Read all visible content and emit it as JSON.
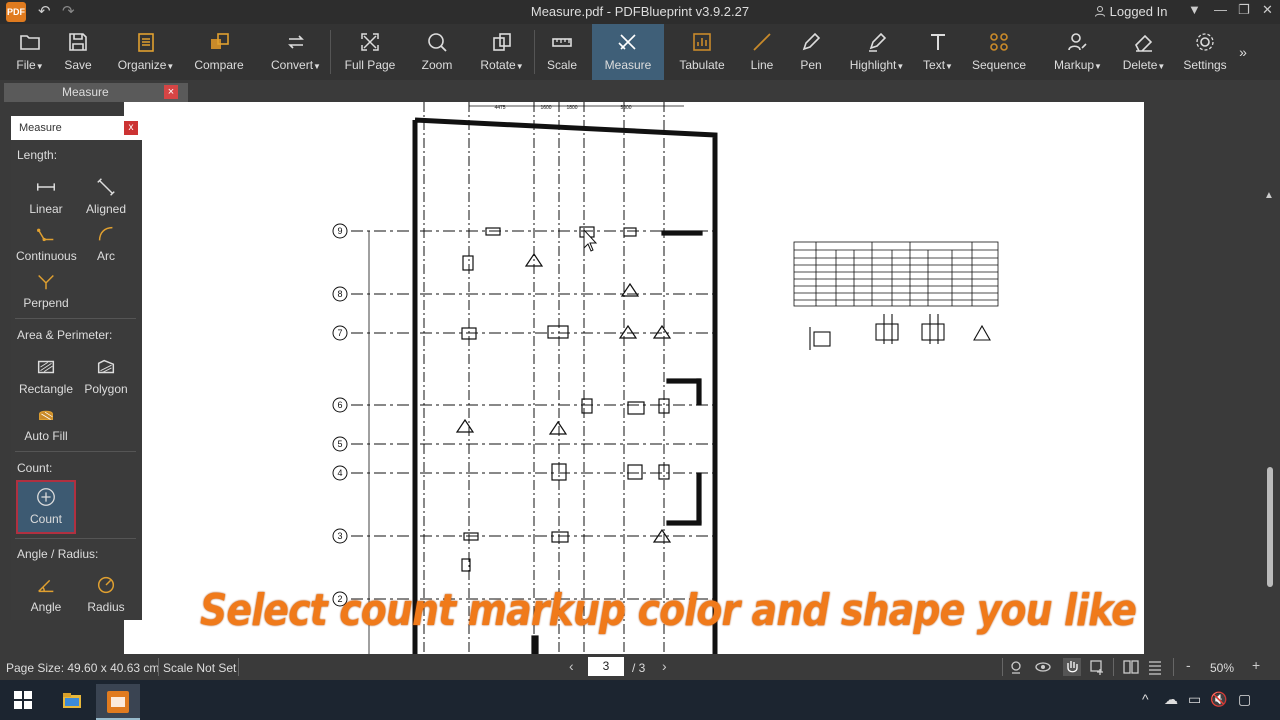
{
  "titlebar": {
    "app_icon_label": "PDF",
    "title": "Measure.pdf - PDFBlueprint v3.9.2.27",
    "login": "Logged In"
  },
  "ribbon": {
    "tools": [
      {
        "label": "File",
        "icon": "folder-icon",
        "dropdown": true
      },
      {
        "label": "Save",
        "icon": "save-icon"
      },
      {
        "label": "Organize",
        "icon": "organize-icon",
        "dropdown": true
      },
      {
        "label": "Compare",
        "icon": "compare-icon"
      },
      {
        "label": "Convert",
        "icon": "convert-icon",
        "dropdown": true
      },
      {
        "label": "Full Page",
        "icon": "full-page-icon"
      },
      {
        "label": "Zoom",
        "icon": "zoom-icon"
      },
      {
        "label": "Rotate",
        "icon": "rotate-icon",
        "dropdown": true
      },
      {
        "label": "Scale",
        "icon": "scale-icon"
      },
      {
        "label": "Measure",
        "icon": "measure-icon",
        "active": true
      },
      {
        "label": "Tabulate",
        "icon": "tabulate-icon"
      },
      {
        "label": "Line",
        "icon": "line-icon"
      },
      {
        "label": "Pen",
        "icon": "pen-icon"
      },
      {
        "label": "Highlight",
        "icon": "highlight-icon",
        "dropdown": true
      },
      {
        "label": "Text",
        "icon": "text-icon",
        "dropdown": true
      },
      {
        "label": "Sequence",
        "icon": "sequence-icon"
      },
      {
        "label": "Markup",
        "icon": "markup-icon",
        "dropdown": true
      },
      {
        "label": "Delete",
        "icon": "eraser-icon",
        "dropdown": true
      },
      {
        "label": "Settings",
        "icon": "settings-icon"
      }
    ]
  },
  "tab": {
    "label": "Measure",
    "close": "×"
  },
  "panel": {
    "title": "Measure",
    "close": "x",
    "length_heading": "Length:",
    "linear": "Linear",
    "aligned": "Aligned",
    "continuous": "Continuous",
    "arc": "Arc",
    "perpend": "Perpend",
    "area_heading": "Area & Perimeter:",
    "rectangle": "Rectangle",
    "polygon": "Polygon",
    "autofill": "Auto Fill",
    "count_heading": "Count:",
    "count": "Count",
    "angle_heading": "Angle / Radius:",
    "angle": "Angle",
    "radius": "Radius"
  },
  "drawing": {
    "grid_labels": [
      "9",
      "8",
      "7",
      "6",
      "5",
      "4",
      "3",
      "2"
    ],
    "dims_top": [
      "4475",
      "1600",
      "1800",
      "5000"
    ]
  },
  "caption": "Select count markup color and shape you like",
  "statusbar": {
    "page_size": "Page Size: 49.60 x 40.63 cm",
    "scale": "Scale Not Set",
    "current_page": "3",
    "total_pages": "/   3",
    "zoom": "50%",
    "zoom_out": "-",
    "zoom_in": "+"
  },
  "colors": {
    "accent": "#3f5f78",
    "caption": "#f07a1a",
    "close_red": "#d64545",
    "app_icon": "#e07b1f"
  }
}
